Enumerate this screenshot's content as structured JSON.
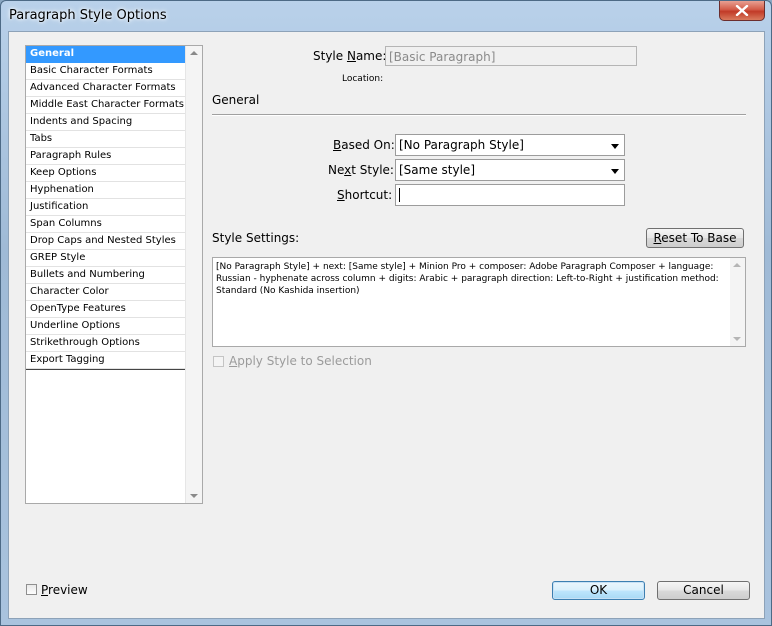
{
  "window": {
    "title": "Paragraph Style Options"
  },
  "categories": [
    "General",
    "Basic Character Formats",
    "Advanced Character Formats",
    "Middle East Character Formats",
    "Indents and Spacing",
    "Tabs",
    "Paragraph Rules",
    "Keep Options",
    "Hyphenation",
    "Justification",
    "Span Columns",
    "Drop Caps and Nested Styles",
    "GREP Style",
    "Bullets and Numbering",
    "Character Color",
    "OpenType Features",
    "Underline Options",
    "Strikethrough Options",
    "Export Tagging"
  ],
  "selected_category": "General",
  "style_name": {
    "label_pre": "Style ",
    "label_key": "N",
    "label_post": "ame:",
    "value": "[Basic Paragraph]"
  },
  "location": {
    "label": "Location:"
  },
  "section_title": "General",
  "based_on": {
    "label_key": "B",
    "label_post": "ased On:",
    "value": "[No Paragraph Style]"
  },
  "next_style": {
    "label_pre": "Ne",
    "label_key": "x",
    "label_post": "t Style:",
    "value": "[Same style]"
  },
  "shortcut": {
    "label_key": "S",
    "label_post": "hortcut:",
    "value": ""
  },
  "style_settings": {
    "label": "Style Settings:",
    "reset_label_key": "R",
    "reset_label_post": "eset To Base",
    "text": "[No Paragraph Style] + next: [Same style] + Minion Pro + composer:  Adobe Paragraph Composer + language: Russian - hyphenate across column + digits: Arabic + paragraph direction: Left-to-Right + justification method: Standard (No Kashida insertion)"
  },
  "apply_style": {
    "label_key": "A",
    "label_post": "pply Style to Selection",
    "checked": false,
    "enabled": false
  },
  "preview": {
    "label_key": "P",
    "label_post": "review",
    "checked": false
  },
  "buttons": {
    "ok": "OK",
    "cancel": "Cancel"
  }
}
